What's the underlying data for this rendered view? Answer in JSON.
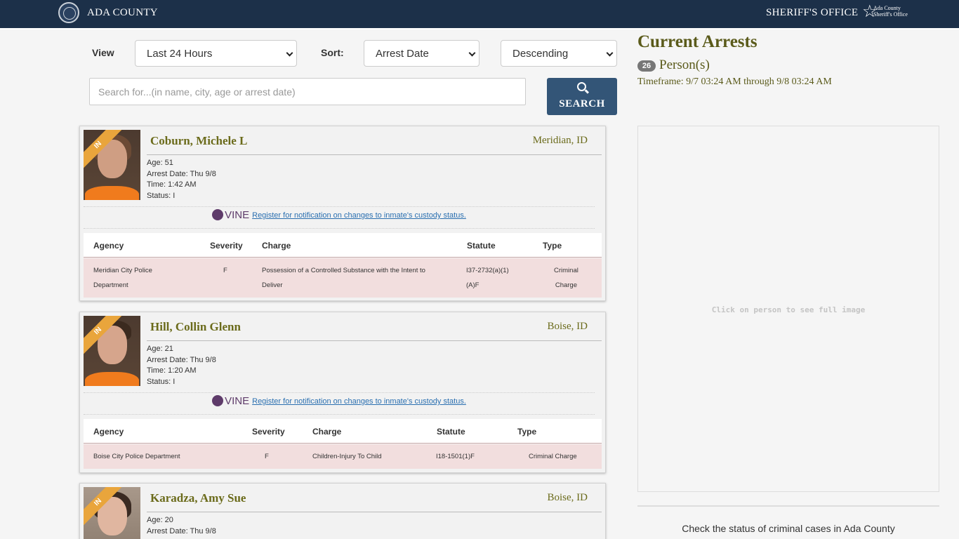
{
  "header": {
    "brand": "ADA COUNTY",
    "office": "SHERIFF'S OFFICE",
    "logo_line1": "Ada County",
    "logo_line2": "Sheriff's Office"
  },
  "filters": {
    "view_label": "View",
    "view_value": "Last 24 Hours",
    "sort_label": "Sort:",
    "sort_value": "Arrest Date",
    "order_value": "Descending",
    "search_placeholder": "Search for...(in name, city, age or arrest date)",
    "search_button": "SEARCH"
  },
  "arrests": [
    {
      "status_tag": "IN",
      "name": "Coburn, Michele L",
      "city": "Meridian, ID",
      "age": "Age: 51",
      "arrest_date": "Arrest Date: Thu 9/8",
      "time": "Time: 1:42 AM",
      "status": "Status: I",
      "vine_brand": "VINE",
      "vine_link": "Register for notification on changes to inmate's custody status.",
      "columns": [
        "Agency",
        "Severity",
        "Charge",
        "Statute",
        "Type"
      ],
      "charges": [
        {
          "agency": [
            "Meridian City Police",
            "Department"
          ],
          "severity": "F",
          "charge": [
            "Possession of a Controlled Substance with the Intent to",
            "Deliver"
          ],
          "statute": [
            "I37-2732(a)(1)",
            "(A)F"
          ],
          "type": [
            "Criminal",
            "Charge"
          ]
        }
      ]
    },
    {
      "status_tag": "IN",
      "name": "Hill, Collin Glenn",
      "city": "Boise, ID",
      "age": "Age: 21",
      "arrest_date": "Arrest Date: Thu 9/8",
      "time": "Time: 1:20 AM",
      "status": "Status: I",
      "vine_brand": "VINE",
      "vine_link": "Register for notification on changes to inmate's custody status.",
      "columns": [
        "Agency",
        "Severity",
        "Charge",
        "Statute",
        "Type"
      ],
      "charges": [
        {
          "agency": "Boise City Police Department",
          "severity": "F",
          "charge": "Children-Injury To Child",
          "statute": "I18-1501(1)F",
          "type": "Criminal Charge"
        }
      ]
    },
    {
      "status_tag": "IN",
      "name": "Karadza, Amy Sue",
      "city": "Boise, ID",
      "age": "Age: 20",
      "arrest_date": "Arrest Date: Thu 9/8"
    }
  ],
  "summary": {
    "title": "Current Arrests",
    "count": "26",
    "persons_label": "Person(s)",
    "timeframe": "Timeframe: 9/7 03:24 AM through 9/8 03:24 AM",
    "preview_hint": "Click on person to see full image",
    "case_status": "Check the status of criminal cases in Ada County"
  }
}
